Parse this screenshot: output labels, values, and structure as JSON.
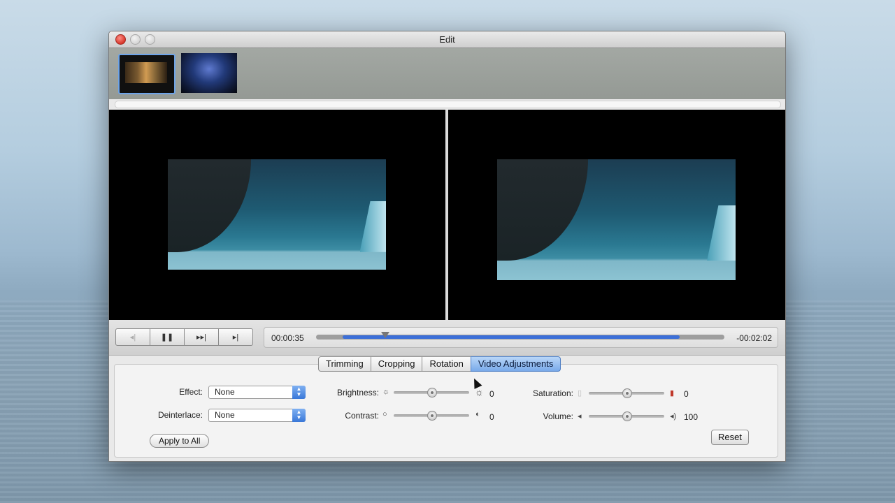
{
  "window": {
    "title": "Edit"
  },
  "thumbnails": [
    {
      "name": "clip-1",
      "selected": true
    },
    {
      "name": "clip-2",
      "selected": false
    }
  ],
  "playback": {
    "current_time": "00:00:35",
    "remaining_time": "-00:02:02",
    "progress_fraction": 0.17,
    "buffered_fraction": 0.89,
    "buttons": [
      "skip-back-icon",
      "pause-icon",
      "fast-forward-icon",
      "skip-end-icon"
    ]
  },
  "tabs": [
    {
      "label": "Trimming",
      "active": false
    },
    {
      "label": "Cropping",
      "active": false
    },
    {
      "label": "Rotation",
      "active": false
    },
    {
      "label": "Video Adjustments",
      "active": true
    }
  ],
  "adjust": {
    "effect_label": "Effect:",
    "effect_value": "None",
    "deinterlace_label": "Deinterlace:",
    "deinterlace_value": "None",
    "brightness_label": "Brightness:",
    "brightness_value": "0",
    "contrast_label": "Contrast:",
    "contrast_value": "0",
    "saturation_label": "Saturation:",
    "saturation_value": "0",
    "volume_label": "Volume:",
    "volume_value": "100",
    "apply_all_label": "Apply to All",
    "reset_label": "Reset"
  },
  "colors": {
    "accent": "#3c6fd8",
    "active_tab": "#79aaea"
  }
}
